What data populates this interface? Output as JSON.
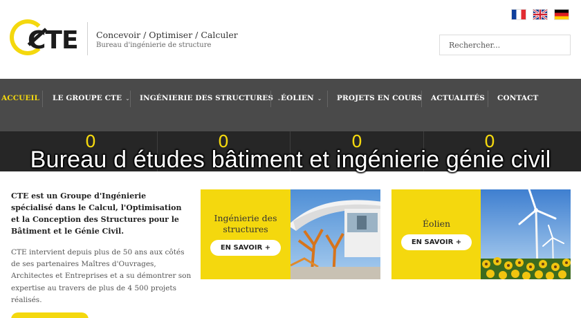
{
  "header": {
    "logo_text": "CTE",
    "tagline": "Concevoir / Optimiser / Calculer",
    "subtagline": "Bureau d'ingénierie de structure",
    "search_placeholder": "Rechercher..."
  },
  "languages": [
    {
      "code": "fr",
      "icon": "flag-fr-icon"
    },
    {
      "code": "en",
      "icon": "flag-uk-icon"
    },
    {
      "code": "de",
      "icon": "flag-de-icon"
    }
  ],
  "nav": {
    "items": [
      {
        "label": "ACCUEIL",
        "active": true,
        "has_dropdown": false
      },
      {
        "label": "LE GROUPE CTE",
        "active": false,
        "has_dropdown": true
      },
      {
        "label": "INGÉNIERIE DES STRUCTURES",
        "active": false,
        "has_dropdown": true
      },
      {
        "label": "ÉOLIEN",
        "active": false,
        "has_dropdown": true
      },
      {
        "label": "PROJETS EN COURS",
        "active": false,
        "has_dropdown": false
      },
      {
        "label": "ACTUALITÉS",
        "active": false,
        "has_dropdown": false
      },
      {
        "label": "CONTACT",
        "active": false,
        "has_dropdown": false
      }
    ],
    "dropdown_glyph": "⌄"
  },
  "stats": [
    "0",
    "0",
    "0",
    "0"
  ],
  "overlay_caption": "Bureau d études bâtiment et ingénierie génie civil",
  "intro": {
    "lead": "CTE est un Groupe d'Ingénierie spécialisé dans le Calcul, l'Optimisation et la Conception des Structures pour le Bâtiment et le Génie Civil.",
    "body": "CTE intervient depuis plus de 50 ans aux côtés de ses partenaires Maîtres d'Ouvrages, Architectes et Entreprises et a su démontrer son expertise au travers de plus de 4 500 projets réalisés."
  },
  "cards": [
    {
      "title_line1": "Ingénierie des",
      "title_line2": "structures",
      "button": "EN SAVOIR +"
    },
    {
      "title_line1": "Éolien",
      "title_line2": "",
      "button": "EN SAVOIR +"
    }
  ],
  "colors": {
    "accent_yellow": "#f4d80e",
    "nav_bg": "#4a4a4a",
    "stats_bg": "#262626"
  }
}
